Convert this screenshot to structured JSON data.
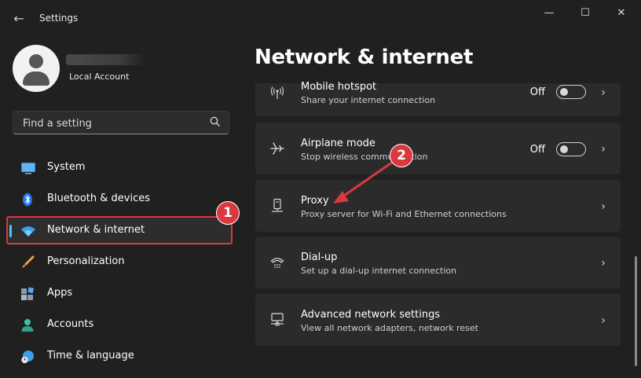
{
  "window": {
    "title": "Settings",
    "back_glyph": "←",
    "minimize_glyph": "—",
    "maximize_glyph": "☐",
    "close_glyph": "✕"
  },
  "account": {
    "type": "Local Account"
  },
  "search": {
    "placeholder": "Find a setting",
    "icon": "search-icon",
    "icon_glyph": "⌕"
  },
  "nav": [
    {
      "label": "System",
      "icon": "system-icon"
    },
    {
      "label": "Bluetooth & devices",
      "icon": "bluetooth-icon"
    },
    {
      "label": "Network & internet",
      "icon": "wifi-icon",
      "active": true
    },
    {
      "label": "Personalization",
      "icon": "brush-icon"
    },
    {
      "label": "Apps",
      "icon": "apps-icon"
    },
    {
      "label": "Accounts",
      "icon": "person-icon"
    },
    {
      "label": "Time & language",
      "icon": "globe-clock-icon"
    }
  ],
  "page": {
    "title": "Network & internet"
  },
  "cards": {
    "hotspot": {
      "title": "Mobile hotspot",
      "subtitle": "Share your internet connection",
      "state": "Off",
      "icon": "hotspot-icon",
      "icon_glyph": "((•))"
    },
    "airplane": {
      "title": "Airplane mode",
      "subtitle": "Stop wireless communication",
      "state": "Off",
      "icon": "airplane-icon",
      "icon_glyph": "✈"
    },
    "proxy": {
      "title": "Proxy",
      "subtitle": "Proxy server for Wi-Fi and Ethernet connections",
      "icon": "proxy-icon",
      "icon_glyph": "⊟"
    },
    "dialup": {
      "title": "Dial-up",
      "subtitle": "Set up a dial-up internet connection",
      "icon": "dialup-icon",
      "icon_glyph": "☏"
    },
    "advanced": {
      "title": "Advanced network settings",
      "subtitle": "View all network adapters, network reset",
      "icon": "network-computer-icon",
      "icon_glyph": "🖳"
    },
    "chevron_glyph": "›"
  },
  "annotations": {
    "badge1": "1",
    "badge2": "2",
    "color": "#d9383f"
  },
  "colors": {
    "accent": "#4cc2ff",
    "background": "#202020",
    "card": "#2b2b2b"
  }
}
